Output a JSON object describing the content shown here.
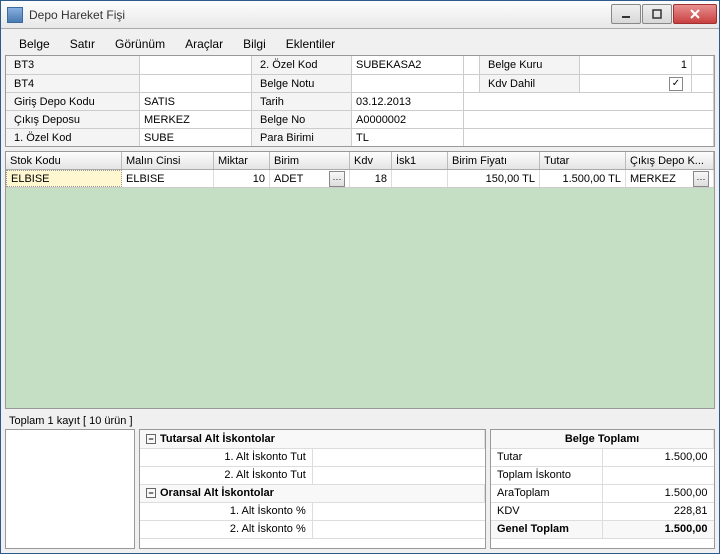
{
  "window": {
    "title": "Depo Hareket Fişi"
  },
  "menu": {
    "belge": "Belge",
    "satir": "Satır",
    "gorunum": "Görünüm",
    "araclar": "Araçlar",
    "bilgi": "Bilgi",
    "eklentiler": "Eklentiler"
  },
  "form": {
    "bt3_label": "BT3",
    "bt3_value": "",
    "bt4_label": "BT4",
    "bt4_value": "",
    "giris_depo_label": "Giriş Depo Kodu",
    "giris_depo_value": "SATIS",
    "cikis_deposu_label": "Çıkış Deposu",
    "cikis_deposu_value": "MERKEZ",
    "ozel_kod1_label": "1. Özel Kod",
    "ozel_kod1_value": "SUBE",
    "ozel_kod2_label": "2. Özel Kod",
    "ozel_kod2_value": "SUBEKASA2",
    "belge_notu_label": "Belge Notu",
    "belge_notu_value": "",
    "tarih_label": "Tarih",
    "tarih_value": "03.12.2013",
    "belge_no_label": "Belge No",
    "belge_no_value": "A0000002",
    "para_birimi_label": "Para Birimi",
    "para_birimi_value": "TL",
    "belge_kuru_label": "Belge Kuru",
    "belge_kuru_value": "1",
    "kdv_dahil_label": "Kdv Dahil",
    "kdv_dahil_checked": "✓"
  },
  "grid": {
    "headers": {
      "stok_kodu": "Stok Kodu",
      "malin_cinsi": "Malın Cinsi",
      "miktar": "Miktar",
      "birim": "Birim",
      "kdv": "Kdv",
      "isk1": "İsk1",
      "birim_fiyati": "Birim Fiyatı",
      "tutar": "Tutar",
      "cikis_depo": "Çıkış Depo K..."
    },
    "row1": {
      "stok_kodu": "ELBISE",
      "malin_cinsi": "ELBISE",
      "miktar": "10",
      "birim": "ADET",
      "kdv": "18",
      "isk1": "",
      "birim_fiyati": "150,00 TL",
      "tutar": "1.500,00 TL",
      "cikis_depo": "MERKEZ"
    }
  },
  "summary_line": "Toplam 1 kayıt [ 10 ürün ]",
  "discounts": {
    "tutarsal_header": "Tutarsal Alt İskontolar",
    "tut1_label": "1. Alt İskonto Tut",
    "tut1_value": "",
    "tut2_label": "2. Alt İskonto Tut",
    "tut2_value": "",
    "oransal_header": "Oransal Alt İskontolar",
    "oran1_label": "1. Alt İskonto %",
    "oran1_value": "",
    "oran2_label": "2. Alt İskonto %",
    "oran2_value": ""
  },
  "totals": {
    "header": "Belge Toplamı",
    "tutar_label": "Tutar",
    "tutar_value": "1.500,00",
    "toplam_iskonto_label": "Toplam İskonto",
    "toplam_iskonto_value": "",
    "aratoplam_label": "AraToplam",
    "aratoplam_value": "1.500,00",
    "kdv_label": "KDV",
    "kdv_value": "228,81",
    "genel_toplam_label": "Genel Toplam",
    "genel_toplam_value": "1.500,00"
  }
}
